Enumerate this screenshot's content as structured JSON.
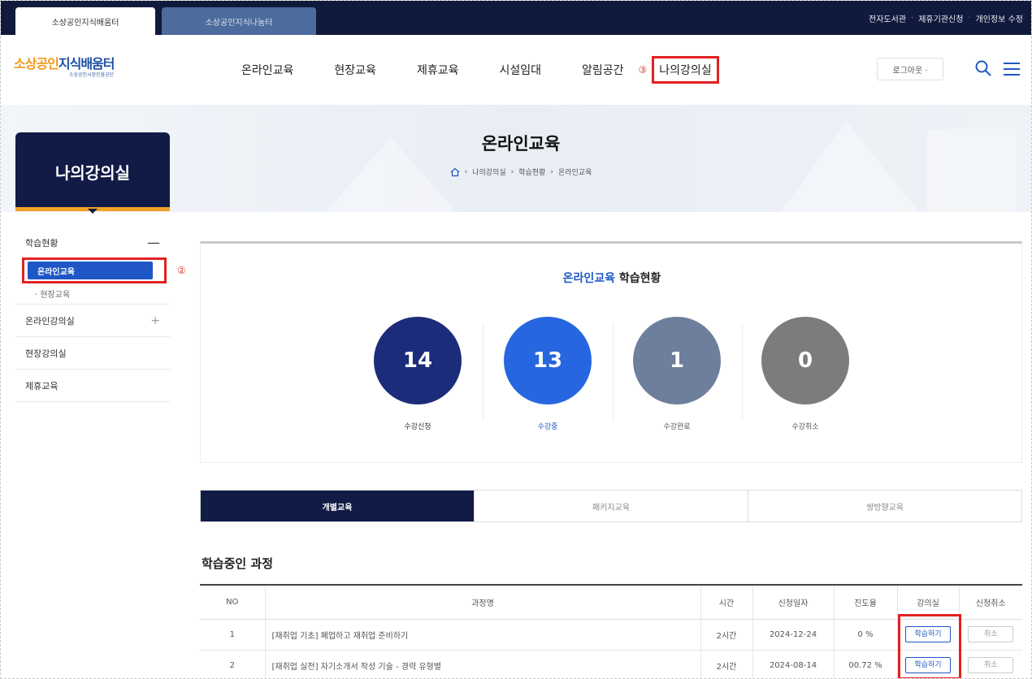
{
  "top_tabs": [
    "소상공인지식배움터",
    "소상공인지식나눔터"
  ],
  "top_links": [
    "전자도서관",
    "제휴기관신청",
    "개인정보 수정"
  ],
  "logo": {
    "title_orange": "소상공인",
    "title_blue": "지식배움터",
    "subtitle": "소상공인시장진흥공단"
  },
  "nav": {
    "items": [
      "온라인교육",
      "현장교육",
      "제휴교육",
      "시설임대",
      "알림공간"
    ],
    "step_marker": "③",
    "my_classroom": "나의강의실"
  },
  "login": "로그아웃 ·",
  "hero": {
    "title": "온라인교육",
    "breadcrumb": [
      "나의강의실",
      "학습현황",
      "온라인교육"
    ],
    "breadcrumb_sep": "›"
  },
  "sidebar": {
    "title": "나의강의실",
    "menu_study": "학습현황",
    "menu_study_toggle": "—",
    "sub_online": "온라인교육",
    "step_marker": "②",
    "sub_field": "· 현장교육",
    "menu_online_class": "온라인강의실",
    "menu_online_class_toggle": "+",
    "menu_field_class": "현장강의실",
    "menu_partner": "제휴교육"
  },
  "summary": {
    "title_highlight": "온라인교육",
    "title_rest": " 학습현황",
    "stats": [
      {
        "label": "수강신청",
        "value": "14",
        "color": "#1b2c7a"
      },
      {
        "label": "수강중",
        "value": "13",
        "color": "#2666e0"
      },
      {
        "label": "수강완료",
        "value": "1",
        "color": "#6d7f9c"
      },
      {
        "label": "수강취소",
        "value": "0",
        "color": "#7c7c7c"
      }
    ]
  },
  "edu_tabs": [
    "개별교육",
    "패키지교육",
    "쌍방향교육"
  ],
  "section_title": "학습중인 과정",
  "table": {
    "headers": [
      "NO",
      "과정명",
      "시간",
      "신청일자",
      "진도율",
      "강의실",
      "신청취소"
    ],
    "rows": [
      {
        "no": "1",
        "title": "[재취업 기초] 폐업하고 재취업 준비하기",
        "time": "2시간",
        "date": "2024-12-24",
        "progress": "0 %",
        "study": "학습하기",
        "cancel": "취소"
      },
      {
        "no": "2",
        "title": "[재취업 실전] 자기소개서 작성 기술 - 경력 유형별",
        "time": "2시간",
        "date": "2024-08-14",
        "progress": "00.72 %",
        "study": "학습하기",
        "cancel": "취소"
      }
    ]
  },
  "colors": {
    "navy": "#111b46",
    "blue": "#1e57c5",
    "accent_orange": "#f2a227",
    "highlight_red": "#e32121"
  }
}
